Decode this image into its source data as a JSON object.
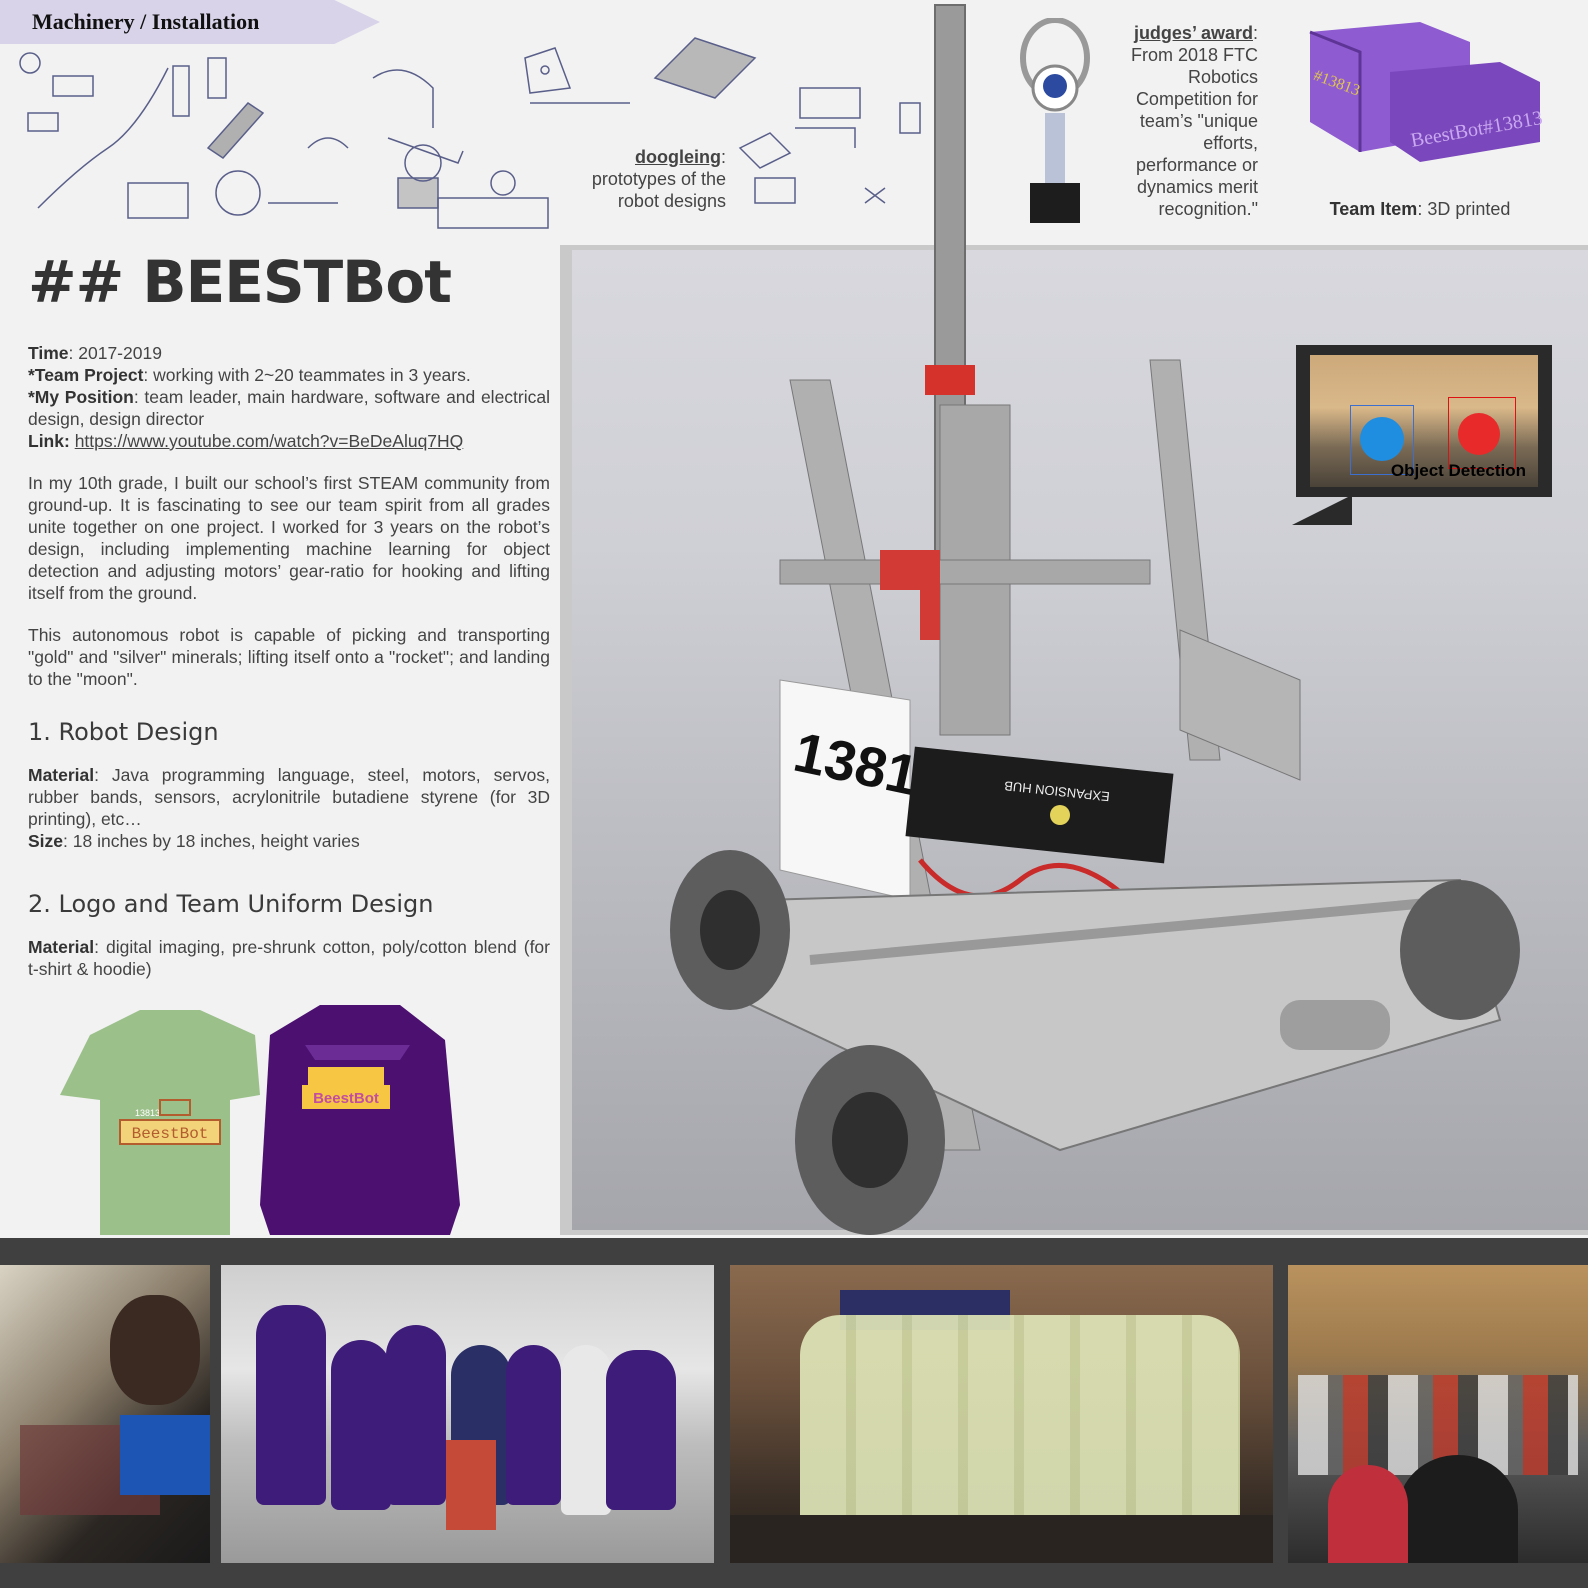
{
  "banner": {
    "label": "Machinery / Installation"
  },
  "captions": {
    "doodle_title": "doogleing",
    "doodle_text": "prototypes of the robot designs",
    "judges_title": "judges’ award",
    "judges_text": "From 2018 FTC Robotics Competition for team’s \"unique efforts, performance or dynamics merit recognition.\"",
    "team_item_title": "Team Item",
    "team_item_text": ": 3D printed"
  },
  "main": {
    "title": "## BEESTBot",
    "time_label": "Time",
    "time_value": ": 2017-2019",
    "team_label": "*Team Project",
    "team_value": ": working with 2~20 teammates in 3 years.",
    "position_label": "*My Position",
    "position_value": ": team leader, main hardware, software and electrical design, design director",
    "link_label": "Link:",
    "link_url": "https://www.youtube.com/watch?v=BeDeAluq7HQ",
    "para1": "In my 10th grade, I built our school’s first STEAM community from ground-up. It is fascinating to see our team spirit from all grades unite together on one project. I worked for 3 years on the robot’s design, including implementing machine learning for object detection and adjusting motors’ gear-ratio for hooking and lifting itself from the ground.",
    "para2": "This autonomous robot is capable of picking and transporting \"gold\" and \"silver\" minerals; lifting itself onto a \"rocket\"; and landing to the \"moon\".",
    "section1": "1. Robot Design",
    "material1_label": "Material",
    "material1_value": ": Java programming language, steel, motors, servos, rubber bands, sensors, acrylonitrile butadiene styrene (for 3D printing), etc…",
    "size_label": "Size",
    "size_value": ": 18 inches by 18 inches, height varies",
    "section2": "2. Logo and Team Uniform Design",
    "material2_label": "Material",
    "material2_value": ": digital imaging, pre-shrunk cotton, poly/cotton blend (for t-shirt & hoodie)"
  },
  "uniform": {
    "tshirt_text": "BeestBot",
    "tshirt_number": "13813",
    "hoodie_text": "BeestBot"
  },
  "robot": {
    "number": "13813",
    "hub_text": "EXPANSION HUB"
  },
  "team_item": {
    "text": "BeestBot#13813",
    "side": "#13813"
  },
  "object_detection": {
    "label": "Object Detection"
  },
  "colors": {
    "accent": "#d9d3ea",
    "hoodie": "#4b1070",
    "tshirt": "#9bc08a",
    "strip": "#404040"
  }
}
